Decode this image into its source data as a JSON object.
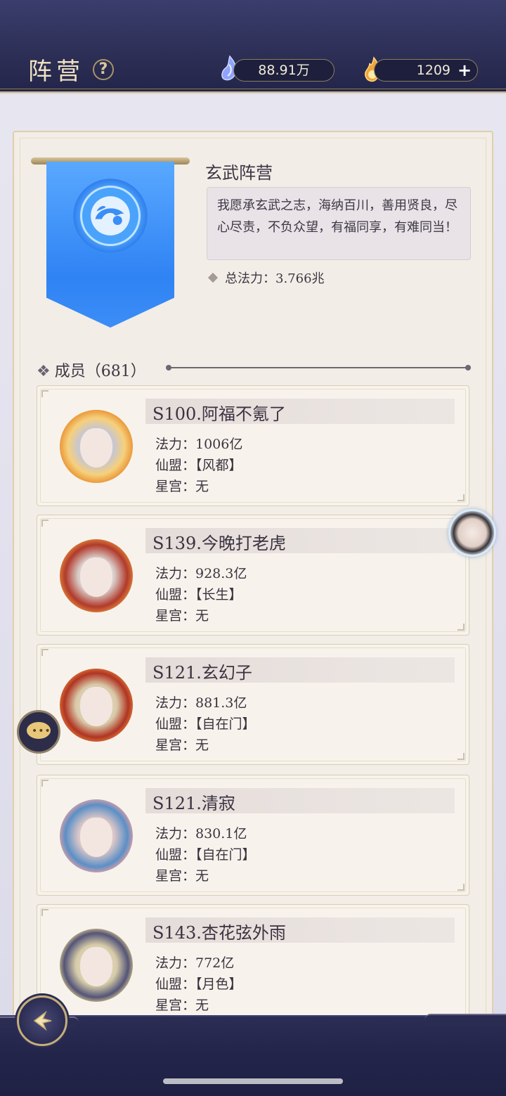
{
  "header": {
    "title": "阵营",
    "help_icon": "?",
    "resource_1": {
      "icon": "soul-gem-icon",
      "value": "88.91万"
    },
    "resource_2": {
      "icon": "flame-coin-icon",
      "value": "1209",
      "add_label": "+"
    }
  },
  "faction": {
    "banner_icon": "turtle-snake-emblem-icon",
    "name": "玄武阵营",
    "motto": "我愿承玄武之志，海纳百川，善用贤良，尽心尽责，不负众望，有福同享，有难同当！",
    "total_power_label": "总法力：3.766兆"
  },
  "members": {
    "header_symbol": "❖",
    "header_label": "成员（681）",
    "list": [
      {
        "name": "S100.阿福不氪了",
        "power": "法力：1006亿",
        "alliance": "仙盟：【风都】",
        "palace": "星宫：无"
      },
      {
        "name": "S139.今晚打老虎",
        "power": "法力：928.3亿",
        "alliance": "仙盟：【长生】",
        "palace": "星宫：无"
      },
      {
        "name": "S121.玄幻子",
        "power": "法力：881.3亿",
        "alliance": "仙盟：【自在门】",
        "palace": "星宫：无"
      },
      {
        "name": "S121.清寂",
        "power": "法力：830.1亿",
        "alliance": "仙盟：【自在门】",
        "palace": "星宫：无"
      },
      {
        "name": "S143.杏花弦外雨",
        "power": "法力：772亿",
        "alliance": "仙盟：【月色】",
        "palace": "星宫：无"
      }
    ]
  },
  "floating": {
    "chat_icon": "chat-bubble-icon",
    "avatar_icon": "character-avatar-icon"
  },
  "navigation": {
    "back_icon": "back-arrow-icon"
  },
  "colors": {
    "header_bg": "#2a2c52",
    "gold_accent": "#c9b27a",
    "banner_blue": "#2f83f3",
    "panel_bg": "#f2ede6"
  }
}
